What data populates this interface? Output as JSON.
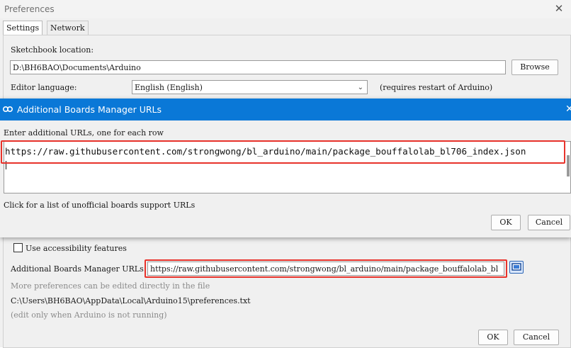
{
  "window": {
    "title": "Preferences"
  },
  "tabs": {
    "settings": "Settings",
    "network": "Network"
  },
  "settings": {
    "sketchbook_label": "Sketchbook location:",
    "sketchbook_value": "D:\\BH6BAO\\Documents\\Arduino",
    "browse_label": "Browse",
    "editor_language_label": "Editor language:",
    "editor_language_value": "English (English)",
    "restart_note": "(requires restart of Arduino)",
    "accessibility_label": "Use accessibility features",
    "boards_url_label": "Additional Boards Manager URLs:",
    "boards_url_value": "https://raw.githubusercontent.com/strongwong/bl_arduino/main/package_bouffalolab_bl",
    "more_prefs_note": "More preferences can be edited directly in the file",
    "prefs_path": "C:\\Users\\BH6BAO\\AppData\\Local\\Arduino15\\preferences.txt",
    "edit_note": "(edit only when Arduino is not running)",
    "ok_label": "OK",
    "cancel_label": "Cancel"
  },
  "dialog": {
    "title": "Additional Boards Manager URLs",
    "instruction": "Enter additional URLs, one for each row",
    "url_text": "https://raw.githubusercontent.com/strongwong/bl_arduino/main/package_bouffalolab_bl706_index.json",
    "link_text": "Click for a list of unofficial boards support URLs",
    "ok_label": "OK",
    "cancel_label": "Cancel"
  },
  "colors": {
    "dialog_titlebar": "#0a78d7",
    "highlight": "#e8332b"
  }
}
